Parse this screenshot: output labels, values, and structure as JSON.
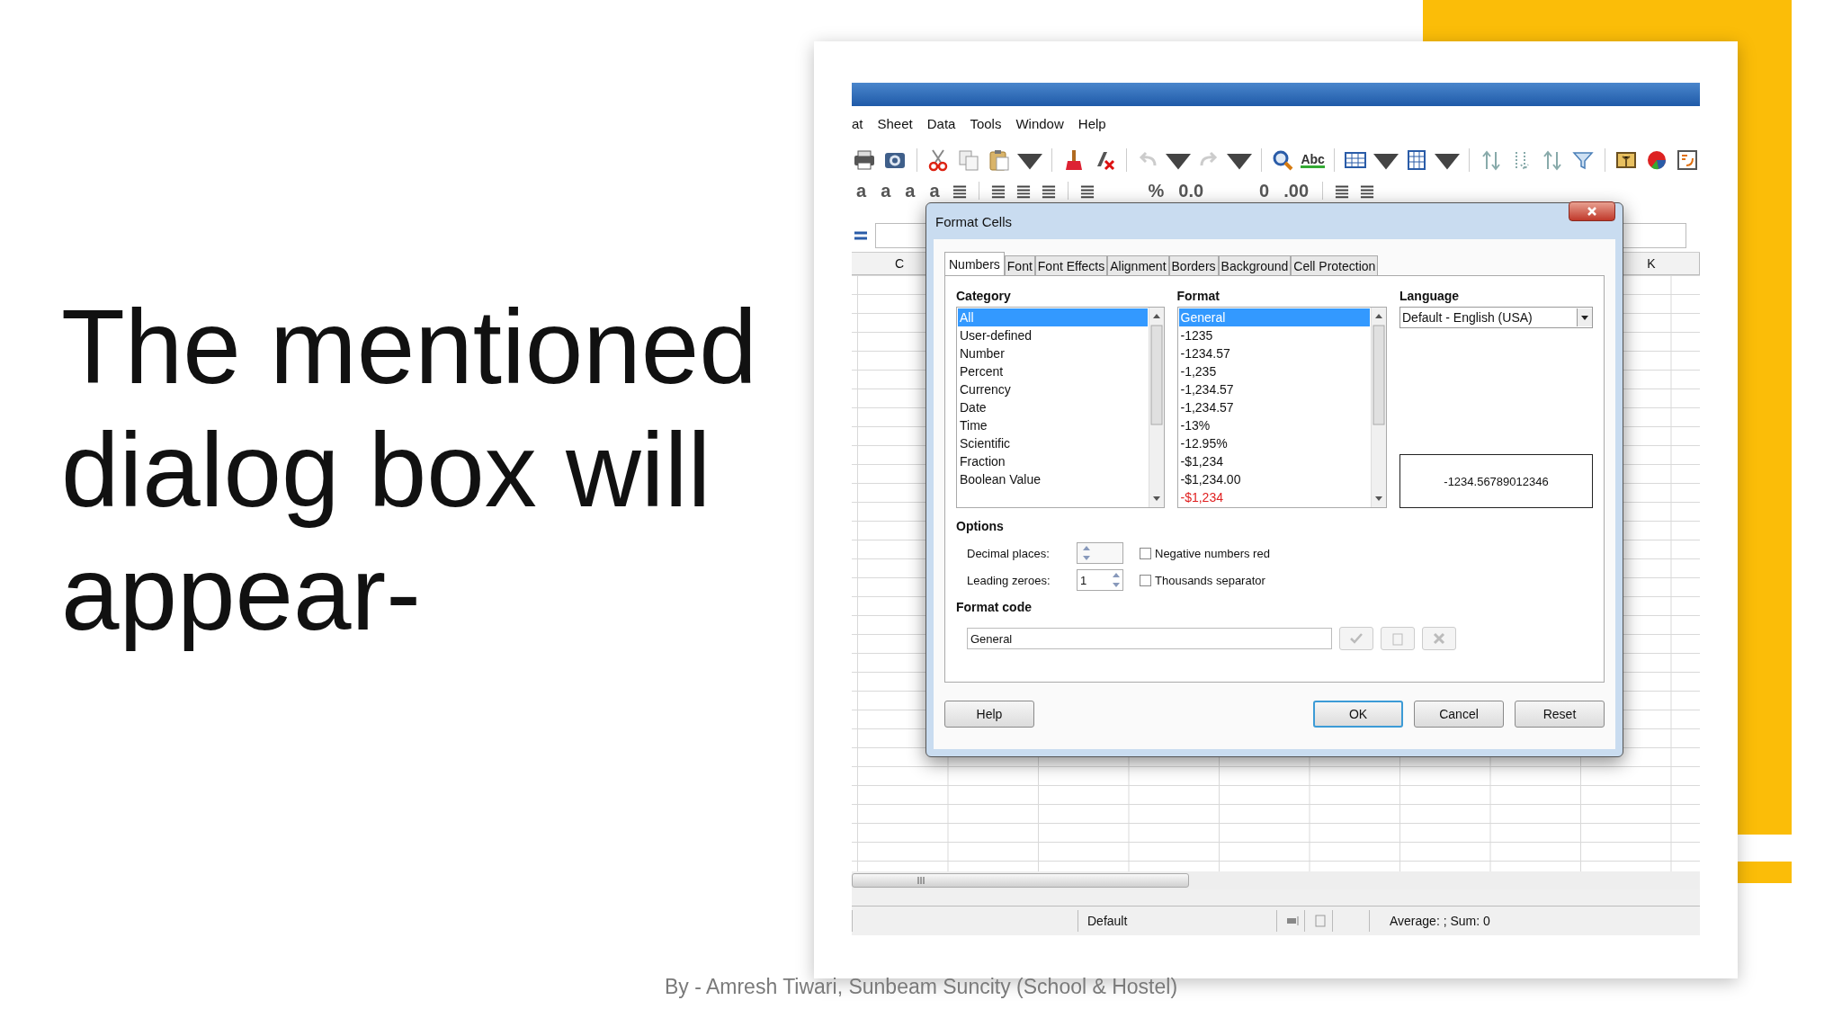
{
  "slide": {
    "heading_lines": [
      "The mentioned",
      "dialog box will",
      "appear-"
    ],
    "footer": "By - Amresh Tiwari, Sunbeam Suncity (School & Hostel)"
  },
  "app": {
    "menu": [
      "at",
      "Sheet",
      "Data",
      "Tools",
      "Window",
      "Help"
    ],
    "toolbar": [
      {
        "kind": "printer"
      },
      {
        "kind": "camera"
      },
      {
        "kind": "sep"
      },
      {
        "kind": "scissors"
      },
      {
        "kind": "copy"
      },
      {
        "kind": "paste"
      },
      {
        "kind": "caret"
      },
      {
        "kind": "sep"
      },
      {
        "kind": "brush"
      },
      {
        "kind": "clear"
      },
      {
        "kind": "sep"
      },
      {
        "kind": "undo"
      },
      {
        "kind": "caret"
      },
      {
        "kind": "redo"
      },
      {
        "kind": "caret"
      },
      {
        "kind": "sep"
      },
      {
        "kind": "find"
      },
      {
        "kind": "spell",
        "label": "Abc"
      },
      {
        "kind": "sep"
      },
      {
        "kind": "table"
      },
      {
        "kind": "caret"
      },
      {
        "kind": "columns"
      },
      {
        "kind": "caret"
      },
      {
        "kind": "sep"
      },
      {
        "kind": "sortup"
      },
      {
        "kind": "sortdown"
      },
      {
        "kind": "sortup"
      },
      {
        "kind": "filter"
      },
      {
        "kind": "sep"
      },
      {
        "kind": "image"
      },
      {
        "kind": "chart"
      },
      {
        "kind": "navigator"
      }
    ],
    "format_toolbar": [
      {
        "kind": "text",
        "label": "a"
      },
      {
        "kind": "text",
        "label": "a"
      },
      {
        "kind": "text",
        "label": "a"
      },
      {
        "kind": "text",
        "label": "a"
      },
      {
        "kind": "align"
      },
      {
        "kind": "sep"
      },
      {
        "kind": "align"
      },
      {
        "kind": "align"
      },
      {
        "kind": "align"
      },
      {
        "kind": "sep"
      },
      {
        "kind": "align"
      },
      {
        "kind": "gap"
      },
      {
        "kind": "text",
        "label": "%"
      },
      {
        "kind": "text",
        "label": "0.0"
      },
      {
        "kind": "gap"
      },
      {
        "kind": "text",
        "label": "0"
      },
      {
        "kind": "text",
        "label": ".00"
      },
      {
        "kind": "sep"
      },
      {
        "kind": "align"
      },
      {
        "kind": "align"
      }
    ],
    "column_headers": [
      "C",
      "K"
    ],
    "status": {
      "style": "Default",
      "summary": "Average: ; Sum: 0"
    }
  },
  "dialog": {
    "title": "Format Cells",
    "tabs": [
      {
        "label": "Numbers",
        "selected": true
      },
      {
        "label": "Font",
        "selected": false
      },
      {
        "label": "Font Effects",
        "selected": false
      },
      {
        "label": "Alignment",
        "selected": false
      },
      {
        "label": "Borders",
        "selected": false
      },
      {
        "label": "Background",
        "selected": false
      },
      {
        "label": "Cell Protection",
        "selected": false
      }
    ],
    "category": {
      "label": "Category",
      "items": [
        {
          "label": "All",
          "selected": true
        },
        {
          "label": "User-defined",
          "selected": false
        },
        {
          "label": "Number",
          "selected": false
        },
        {
          "label": "Percent",
          "selected": false
        },
        {
          "label": "Currency",
          "selected": false
        },
        {
          "label": "Date",
          "selected": false
        },
        {
          "label": "Time",
          "selected": false
        },
        {
          "label": "Scientific",
          "selected": false
        },
        {
          "label": "Fraction",
          "selected": false
        },
        {
          "label": "Boolean Value",
          "selected": false
        }
      ]
    },
    "format": {
      "label": "Format",
      "items": [
        {
          "label": "General",
          "selected": true
        },
        {
          "label": "-1235",
          "selected": false
        },
        {
          "label": "-1234.57",
          "selected": false
        },
        {
          "label": "-1,235",
          "selected": false
        },
        {
          "label": "-1,234.57",
          "selected": false
        },
        {
          "label": "-1,234.57",
          "selected": false
        },
        {
          "label": "-13%",
          "selected": false
        },
        {
          "label": "-12.95%",
          "selected": false
        },
        {
          "label": "-$1,234",
          "selected": false
        },
        {
          "label": "-$1,234.00",
          "selected": false
        },
        {
          "label": "-$1,234",
          "selected": false,
          "color": "#e02020"
        }
      ]
    },
    "language": {
      "label": "Language",
      "value": "Default - English (USA)"
    },
    "preview": "-1234.56789012346",
    "options": {
      "label": "Options",
      "decimal_places": {
        "label": "Decimal places:"
      },
      "leading_zeroes": {
        "label": "Leading zeroes:",
        "value": "1"
      },
      "checks": [
        {
          "label": "Negative numbers red",
          "checked": false
        },
        {
          "label": "Thousands separator",
          "checked": false
        }
      ]
    },
    "format_code": {
      "label": "Format code",
      "value": "General"
    },
    "buttons": [
      {
        "label": "Help",
        "kind": "help"
      },
      {
        "label": "OK",
        "kind": "default"
      },
      {
        "label": "Cancel",
        "kind": "normal"
      },
      {
        "label": "Reset",
        "kind": "normal"
      }
    ]
  }
}
